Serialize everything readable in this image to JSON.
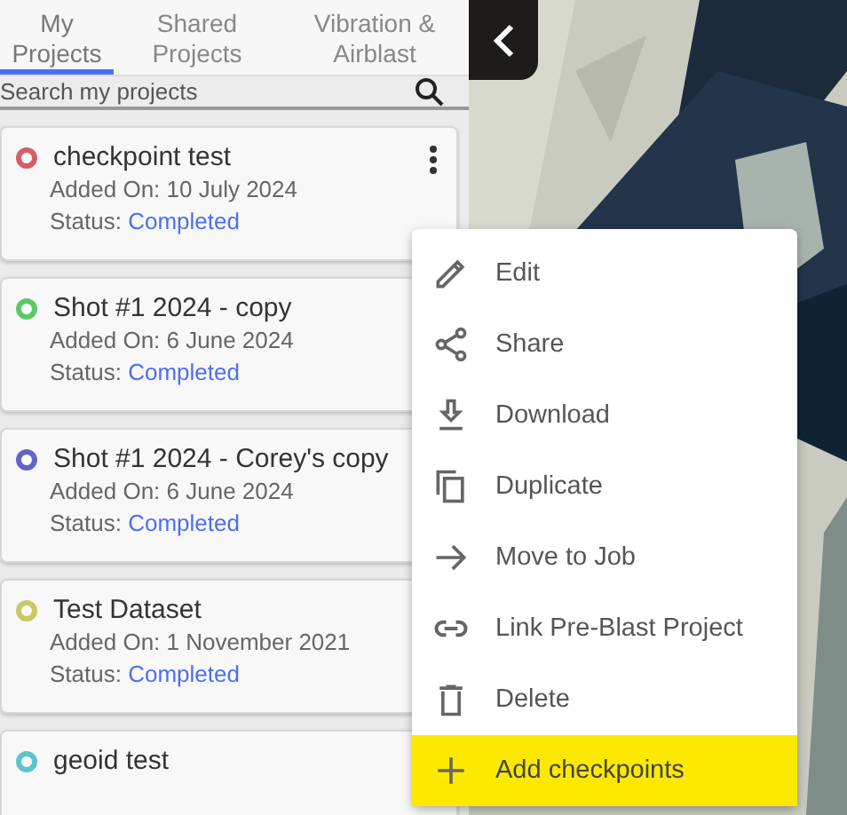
{
  "tabs": [
    {
      "label": "My Projects",
      "selected": true
    },
    {
      "label": "Shared Projects",
      "selected": false
    },
    {
      "label": "Vibration & Airblast",
      "selected": false
    }
  ],
  "search": {
    "placeholder": "Search my projects"
  },
  "projects": [
    {
      "name": "checkpoint test",
      "added": "Added On: 10 July 2024",
      "status_label": "Status:",
      "status": "Completed",
      "color": "#d45f66"
    },
    {
      "name": "Shot #1 2024 - copy",
      "added": "Added On: 6 June 2024",
      "status_label": "Status:",
      "status": "Completed",
      "color": "#5dc86a"
    },
    {
      "name": "Shot #1 2024 - Corey's copy",
      "added": "Added On: 6 June 2024",
      "status_label": "Status:",
      "status": "Completed",
      "color": "#6464c8"
    },
    {
      "name": "Test Dataset",
      "added": "Added On: 1 November 2021",
      "status_label": "Status:",
      "status": "Completed",
      "color": "#c8c864"
    },
    {
      "name": "geoid test",
      "color": "#5cc4cc"
    }
  ],
  "context_menu": {
    "items": [
      {
        "label": "Edit",
        "highlighted": false
      },
      {
        "label": "Share",
        "highlighted": false
      },
      {
        "label": "Download",
        "highlighted": false
      },
      {
        "label": "Duplicate",
        "highlighted": false
      },
      {
        "label": "Move to Job",
        "highlighted": false
      },
      {
        "label": "Link Pre-Blast Project",
        "highlighted": false
      },
      {
        "label": "Delete",
        "highlighted": false
      },
      {
        "label": "Add checkpoints",
        "highlighted": true
      }
    ]
  }
}
